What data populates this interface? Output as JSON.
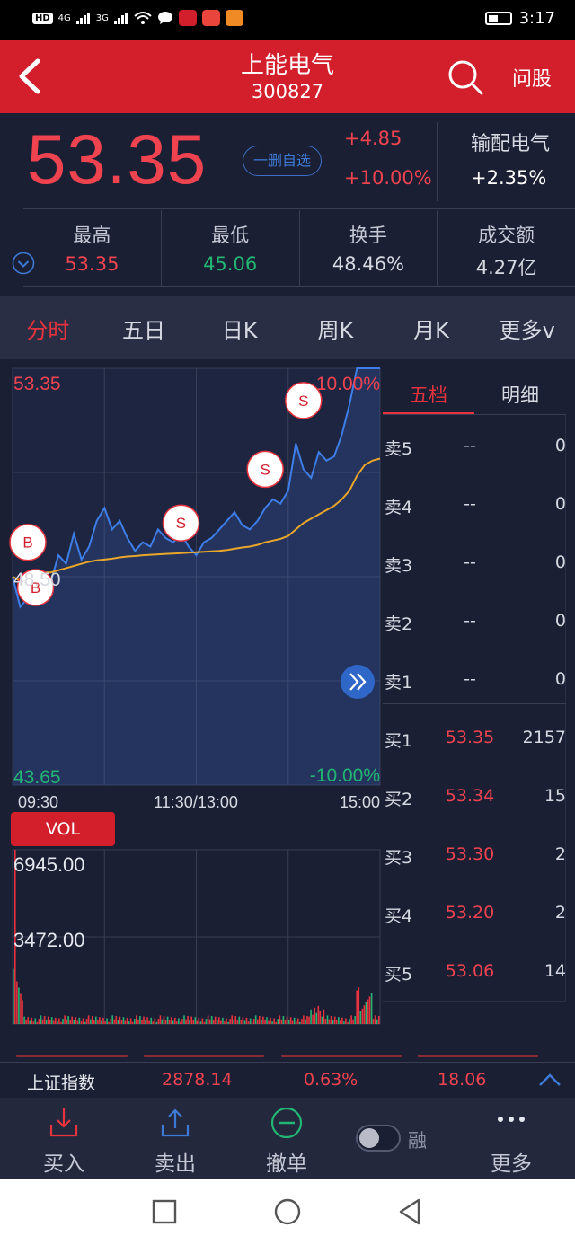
{
  "status_bar": {
    "left_chips": [
      "HD",
      "4G",
      "3G"
    ],
    "time": "3:17"
  },
  "header": {
    "title": "上能电气",
    "code": "300827",
    "ask_label": "问股"
  },
  "quote": {
    "price": "53.35",
    "change": "+4.85",
    "change_pct": "+10.00%",
    "favorite_label": "一删自选",
    "sector_name": "输配电气",
    "sector_change": "+2.35%",
    "stats": [
      {
        "label": "最高",
        "value": "53.35",
        "color": "#ef4350"
      },
      {
        "label": "最低",
        "value": "45.06",
        "color": "#22b573"
      },
      {
        "label": "换手",
        "value": "48.46%",
        "color": "#d7d9e2"
      },
      {
        "label": "成交额",
        "value": "4.27亿",
        "color": "#d7d9e2"
      }
    ]
  },
  "tabs": [
    "分时",
    "五日",
    "日K",
    "周K",
    "月K",
    "更多v"
  ],
  "chart_data": {
    "type": "line",
    "price_axis": {
      "max": "53.35",
      "mid": "48.50",
      "min": "43.65"
    },
    "pct_axis": {
      "max": "10.00%",
      "min": "-10.00%"
    },
    "x_labels": [
      "09:30",
      "11:30/13:00",
      "15:00"
    ],
    "ylim": [
      43.65,
      53.35
    ],
    "series": [
      {
        "values": [
          48.5,
          47.8,
          48.0,
          48.3,
          48.6,
          48.4,
          49.0,
          48.8,
          49.5,
          48.9,
          49.2,
          49.8,
          50.1,
          49.6,
          49.8,
          49.4,
          49.1,
          49.3,
          49.2,
          49.6,
          49.4,
          49.3,
          49.5,
          49.2,
          49.0,
          49.3,
          49.4,
          49.6,
          49.8,
          50.0,
          49.7,
          49.6,
          49.8,
          50.1,
          50.3,
          50.2,
          50.5,
          51.6,
          51.0,
          50.8,
          51.4,
          51.2,
          51.3,
          51.8,
          52.5,
          53.35,
          53.35,
          53.35,
          53.35
        ]
      },
      {
        "values": [
          48.5,
          48.4,
          48.5,
          48.5,
          48.6,
          48.6,
          48.65,
          48.7,
          48.75,
          48.8,
          48.85,
          48.88,
          48.9,
          48.92,
          48.95,
          48.97,
          48.98,
          49.0,
          49.01,
          49.02,
          49.03,
          49.04,
          49.05,
          49.06,
          49.07,
          49.08,
          49.09,
          49.1,
          49.12,
          49.15,
          49.18,
          49.2,
          49.24,
          49.3,
          49.34,
          49.38,
          49.45,
          49.6,
          49.75,
          49.85,
          49.95,
          50.05,
          50.15,
          50.3,
          50.5,
          50.85,
          51.1,
          51.2,
          51.25
        ]
      }
    ],
    "volume_axis": {
      "max": "6945.00",
      "mid": "3472.00"
    },
    "volume_ylim": [
      0,
      6945
    ],
    "trade_marks": [
      {
        "label": "B",
        "x_index": 2,
        "value": 49.3
      },
      {
        "label": "B",
        "x_index": 3,
        "value": 48.25
      },
      {
        "label": "S",
        "x_index": 22,
        "value": 49.75
      },
      {
        "label": "S",
        "x_index": 33,
        "value": 51.0
      },
      {
        "label": "S",
        "x_index": 38,
        "value": 52.6
      }
    ]
  },
  "order_book": {
    "tabs": [
      "五档",
      "明细"
    ],
    "sell": [
      {
        "name": "卖5",
        "price": "--",
        "vol": "0"
      },
      {
        "name": "卖4",
        "price": "--",
        "vol": "0"
      },
      {
        "name": "卖3",
        "price": "--",
        "vol": "0"
      },
      {
        "name": "卖2",
        "price": "--",
        "vol": "0"
      },
      {
        "name": "卖1",
        "price": "--",
        "vol": "0"
      }
    ],
    "buy": [
      {
        "name": "买1",
        "price": "53.35",
        "vol": "2157"
      },
      {
        "name": "买2",
        "price": "53.34",
        "vol": "15"
      },
      {
        "name": "买3",
        "price": "53.30",
        "vol": "2"
      },
      {
        "name": "买4",
        "price": "53.20",
        "vol": "2"
      },
      {
        "name": "买5",
        "price": "53.06",
        "vol": "14"
      }
    ]
  },
  "vol_label": "VOL",
  "index_bar": {
    "name": "上证指数",
    "value": "2878.14",
    "pct": "0.63%",
    "change": "18.06"
  },
  "toolbar": {
    "buy": "买入",
    "sell": "卖出",
    "cancel": "撤单",
    "margin": "融",
    "more": "更多"
  },
  "colors": {
    "accent_red": "#d21f2b",
    "up": "#ef4350",
    "down": "#22b573",
    "price_line": "#3d7ee8",
    "avg_line": "#e8a62a"
  }
}
